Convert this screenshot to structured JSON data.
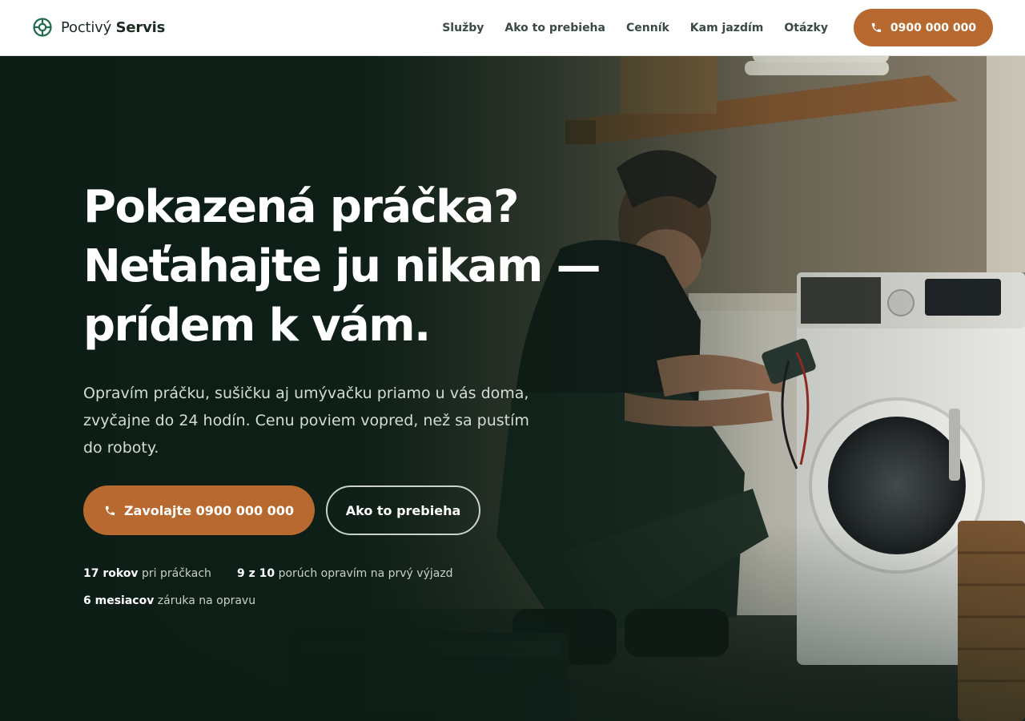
{
  "brand": {
    "name_regular": "Poctivý",
    "name_bold": "Servis",
    "icon": "lifebuoy-icon",
    "color": "#1f6b4a"
  },
  "nav": {
    "items": [
      {
        "label": "Služby"
      },
      {
        "label": "Ako to prebieha"
      },
      {
        "label": "Cenník"
      },
      {
        "label": "Kam jazdím"
      },
      {
        "label": "Otázky"
      }
    ],
    "call_button": {
      "label": "0900 000 000",
      "icon": "phone-icon"
    }
  },
  "hero": {
    "title_lines": [
      "Pokazená práčka?",
      "Neťahajte ju nikam —",
      "prídem k vám."
    ],
    "lead": "Opravím práčku, sušičku aj umývačku priamo u vás doma, zvyčajne do 24 hodín. Cenu poviem vopred, než sa pustím do roboty.",
    "primary_cta": {
      "label": "Zavolajte 0900 000 000",
      "icon": "phone-icon"
    },
    "secondary_cta": {
      "label": "Ako to prebieha"
    },
    "stats": [
      {
        "strong": "17 rokov",
        "text": " pri práčkach"
      },
      {
        "strong": "9 z 10",
        "text": " porúch opravím na prvý výjazd"
      },
      {
        "strong": "6 mesiacov",
        "text": " záruka na opravu"
      }
    ],
    "image": "technician-repairing-washing-machine"
  },
  "colors": {
    "accent": "#b8692f",
    "hero_dark": "#0d1f17",
    "header_bg": "#ffffff",
    "nav_text": "#3a4a42"
  }
}
